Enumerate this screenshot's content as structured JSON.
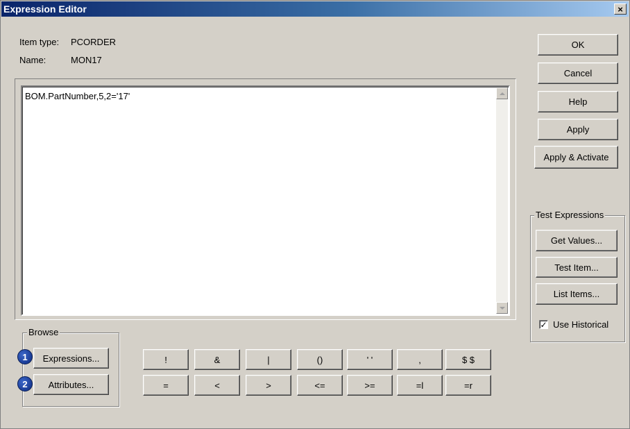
{
  "window": {
    "title": "Expression Editor",
    "close_glyph": "×"
  },
  "item_info": {
    "type_label": "Item type:",
    "type_value": "PCORDER",
    "name_label": "Name:",
    "name_value": "MON17"
  },
  "editor": {
    "expression": "BOM.PartNumber,5,2='17'"
  },
  "actions": {
    "ok": "OK",
    "cancel": "Cancel",
    "help": "Help",
    "apply": "Apply",
    "apply_activate": "Apply & Activate"
  },
  "test_expressions": {
    "legend": "Test Expressions",
    "get_values": "Get Values...",
    "test_item": "Test Item...",
    "list_items": "List Items...",
    "use_historical_label": "Use Historical",
    "use_historical_checked": true,
    "check_glyph": "✓"
  },
  "browse": {
    "legend": "Browse",
    "expressions": "Expressions...",
    "attributes": "Attributes...",
    "badge_1": "1",
    "badge_2": "2"
  },
  "operators": {
    "row1": [
      "!",
      "&",
      "|",
      "()",
      "' '",
      ",",
      "$ $"
    ],
    "row2": [
      "=",
      "<",
      ">",
      "<=",
      ">=",
      "=l",
      "=r"
    ]
  }
}
